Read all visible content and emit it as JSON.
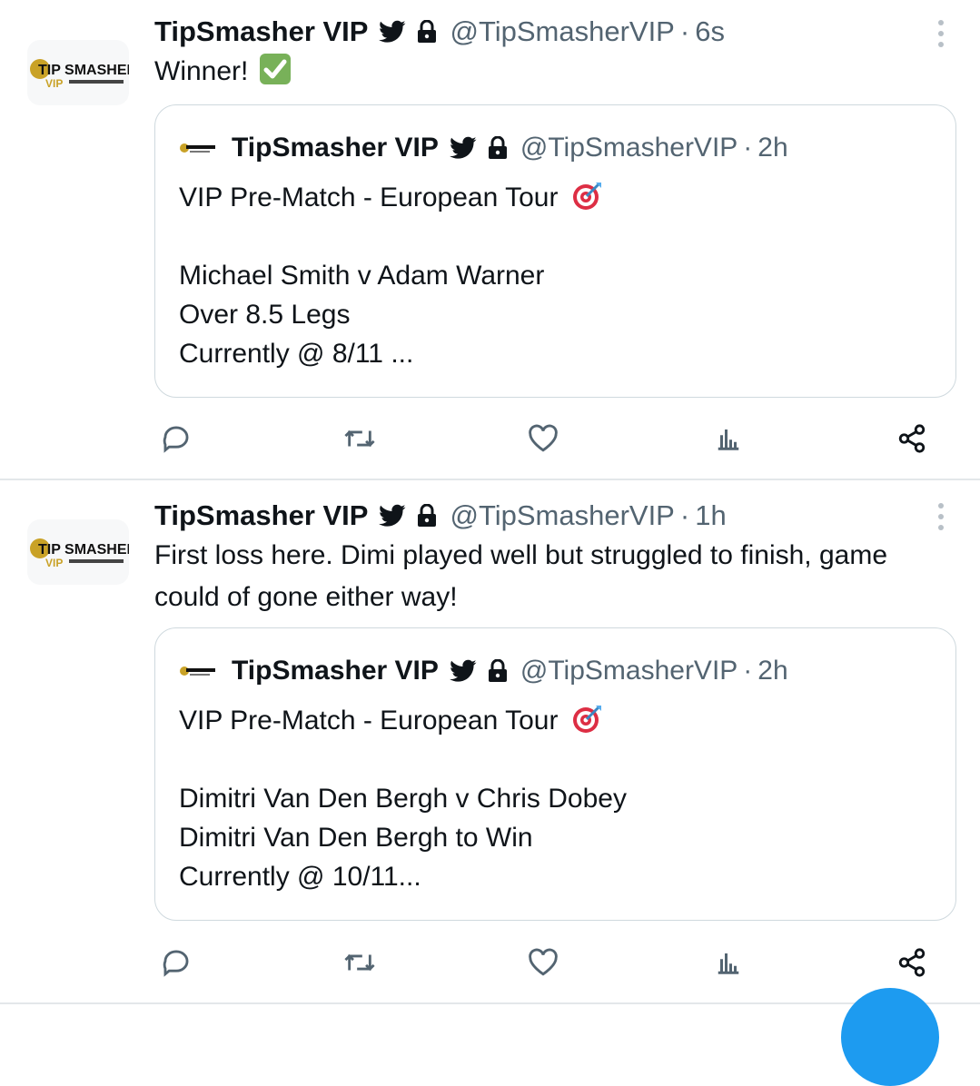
{
  "tweets": [
    {
      "author": {
        "name": "TipSmasher VIP",
        "handle": "@TipSmasherVIP",
        "avatar_text": "TIP SMASHER"
      },
      "time": "6s",
      "text": "Winner!",
      "text_emoji": "check-mark-button",
      "quoted": {
        "author": {
          "name": "TipSmasher VIP",
          "handle": "@TipSmasherVIP"
        },
        "time": "2h",
        "lines": [
          "VIP Pre-Match - European Tour",
          "",
          "Michael Smith v Adam Warner",
          "Over 8.5 Legs",
          "Currently @ 8/11 ..."
        ],
        "title_emoji": "direct-hit"
      }
    },
    {
      "author": {
        "name": "TipSmasher VIP",
        "handle": "@TipSmasherVIP",
        "avatar_text": "TIP SMASHER"
      },
      "time": "1h",
      "text": "First loss here. Dimi played well but struggled to finish, game could of gone either way!",
      "quoted": {
        "author": {
          "name": "TipSmasher VIP",
          "handle": "@TipSmasherVIP"
        },
        "time": "2h",
        "lines": [
          "VIP Pre-Match - European Tour",
          "",
          "Dimitri Van Den Bergh v Chris Dobey",
          "Dimitri Van Den Bergh to Win",
          "Currently @ 10/11..."
        ],
        "title_emoji": "direct-hit"
      }
    }
  ],
  "separator": "·",
  "icons": {
    "verified": "twitter-bird-icon",
    "protected": "lock-icon",
    "more": "more-vertical-icon",
    "actions": [
      "reply-icon",
      "retweet-icon",
      "like-icon",
      "views-icon",
      "share-icon"
    ]
  },
  "colors": {
    "text": "#0f1419",
    "secondary": "#536471",
    "border": "#cfd9de",
    "divider": "#e3e7ea",
    "accent": "#1d9bf0",
    "logo_gold": "#c9a227"
  }
}
